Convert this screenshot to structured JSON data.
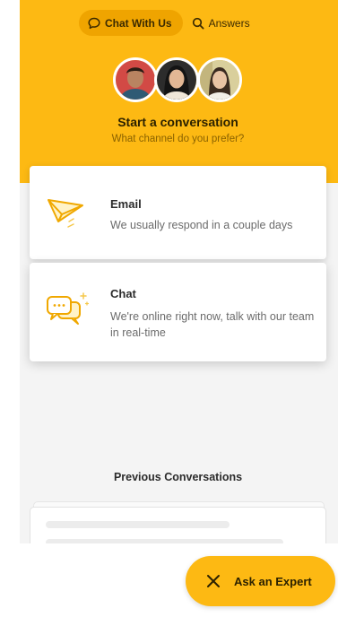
{
  "tabs": {
    "chat_label": "Chat With Us",
    "answers_label": "Answers"
  },
  "header": {
    "title": "Start a conversation",
    "subtitle": "What channel do you prefer?"
  },
  "channels": [
    {
      "title": "Email",
      "description": "We usually respond in a couple days",
      "icon": "paper-plane-icon"
    },
    {
      "title": "Chat",
      "description": "We're online right now, talk with our team in real-time",
      "icon": "chat-bubbles-icon"
    }
  ],
  "previous": {
    "title": "Previous Conversations"
  },
  "fab": {
    "label": "Ask an Expert",
    "icon": "close-icon"
  },
  "colors": {
    "brand": "#FDB913",
    "tab_active": "#EFA400",
    "panel_bg": "#f4f4f4"
  }
}
